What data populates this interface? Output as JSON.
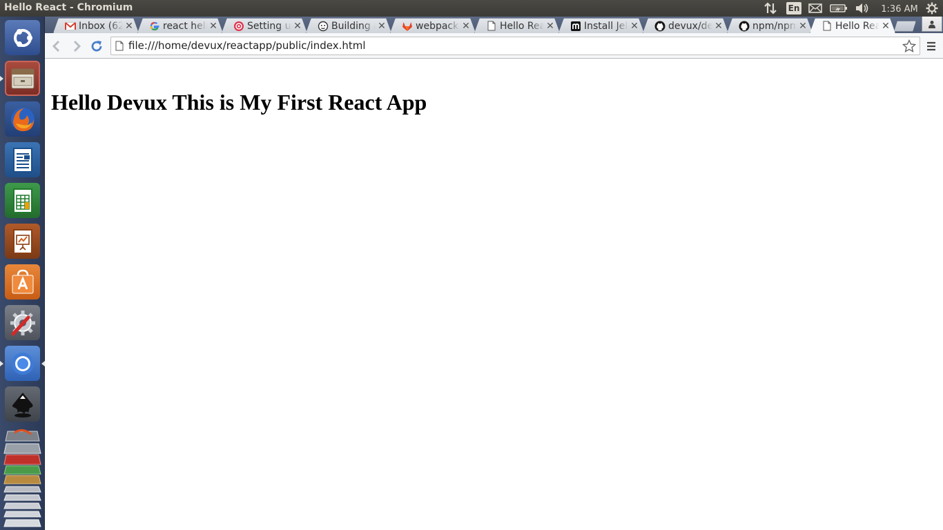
{
  "window": {
    "title": "Hello React - Chromium"
  },
  "panel": {
    "language": "En",
    "clock": "1:36 AM",
    "icons": [
      "network-transfer-icon",
      "keyboard-language-icon",
      "mail-icon",
      "battery-icon",
      "volume-icon",
      "session-gear-icon"
    ]
  },
  "launcher": {
    "items": [
      {
        "name": "dash-home",
        "icon": "ubuntu-logo-icon"
      },
      {
        "name": "files",
        "icon": "file-cabinet-icon"
      },
      {
        "name": "firefox",
        "icon": "firefox-icon"
      },
      {
        "name": "writer",
        "icon": "libreoffice-writer-icon"
      },
      {
        "name": "calc",
        "icon": "libreoffice-calc-icon"
      },
      {
        "name": "impress",
        "icon": "libreoffice-impress-icon"
      },
      {
        "name": "software-center",
        "icon": "software-center-bag-icon"
      },
      {
        "name": "system-settings",
        "icon": "settings-wrench-icon"
      },
      {
        "name": "chromium",
        "icon": "chromium-icon"
      },
      {
        "name": "inkscape",
        "icon": "inkscape-icon"
      },
      {
        "name": "stacked-apps",
        "icon": "stacked-apps-icon"
      }
    ]
  },
  "tabs": [
    {
      "label": "Inbox (62",
      "icon": "gmail-icon",
      "active": false
    },
    {
      "label": "react hell",
      "icon": "google-icon",
      "active": false
    },
    {
      "label": "Setting up",
      "icon": "red-target-icon",
      "active": false
    },
    {
      "label": "Building a",
      "icon": "monkey-face-icon",
      "active": false
    },
    {
      "label": "webpack",
      "icon": "gitlab-fox-icon",
      "active": false
    },
    {
      "label": "Hello Reac",
      "icon": "page-icon",
      "active": false
    },
    {
      "label": "Install Jel",
      "icon": "m-logo-icon",
      "active": false
    },
    {
      "label": "devux/de",
      "icon": "github-icon",
      "active": false
    },
    {
      "label": "npm/npm",
      "icon": "github-icon",
      "active": false
    },
    {
      "label": "Hello Rea",
      "icon": "page-icon",
      "active": true
    }
  ],
  "toolbar": {
    "url": "file:///home/devux/reactapp/public/index.html"
  },
  "page": {
    "heading": "Hello Devux This is My First React App"
  }
}
